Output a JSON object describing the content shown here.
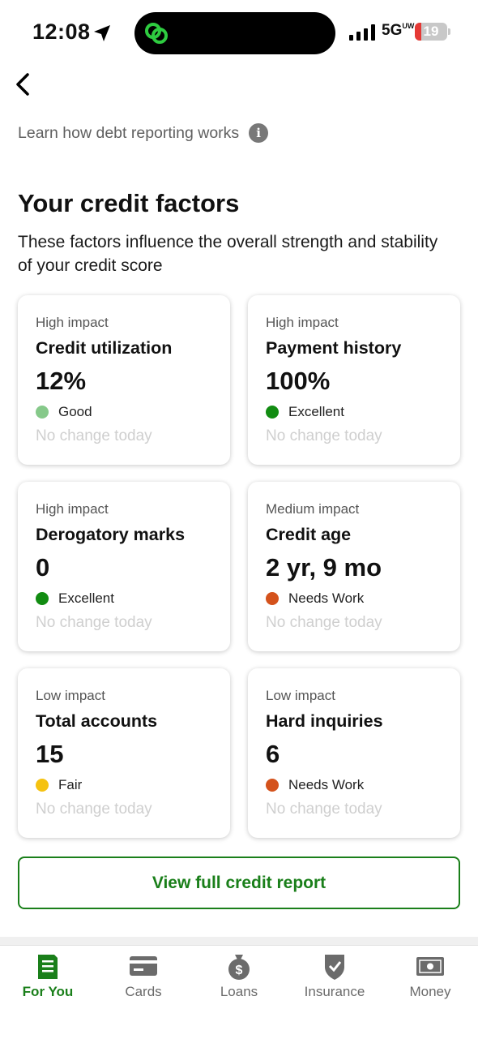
{
  "status_bar": {
    "time": "12:08",
    "network": "5G",
    "network_sub": "UW",
    "battery": "19",
    "battery_level": 0.19
  },
  "header": {
    "learn_link": "Learn how debt reporting works"
  },
  "section": {
    "title": "Your credit factors",
    "description": "These factors influence the overall strength and stability of your credit score"
  },
  "factors": [
    {
      "impact": "High impact",
      "name": "Credit utilization",
      "value": "12%",
      "rating": "Good",
      "rating_color": "#86c98a",
      "change": "No change today"
    },
    {
      "impact": "High impact",
      "name": "Payment history",
      "value": "100%",
      "rating": "Excellent",
      "rating_color": "#128c12",
      "change": "No change today"
    },
    {
      "impact": "High impact",
      "name": "Derogatory marks",
      "value": "0",
      "rating": "Excellent",
      "rating_color": "#128c12",
      "change": "No change today"
    },
    {
      "impact": "Medium impact",
      "name": "Credit age",
      "value": "2 yr, 9 mo",
      "rating": "Needs Work",
      "rating_color": "#d4521c",
      "change": "No change today"
    },
    {
      "impact": "Low impact",
      "name": "Total accounts",
      "value": "15",
      "rating": "Fair",
      "rating_color": "#f5c211",
      "change": "No change today"
    },
    {
      "impact": "Low impact",
      "name": "Hard inquiries",
      "value": "6",
      "rating": "Needs Work",
      "rating_color": "#d4521c",
      "change": "No change today"
    }
  ],
  "report_button": "View full credit report",
  "tabs": [
    {
      "label": "For You",
      "icon": "document-icon",
      "active": true
    },
    {
      "label": "Cards",
      "icon": "credit-card-icon",
      "active": false
    },
    {
      "label": "Loans",
      "icon": "money-bag-icon",
      "active": false
    },
    {
      "label": "Insurance",
      "icon": "shield-check-icon",
      "active": false
    },
    {
      "label": "Money",
      "icon": "banknote-icon",
      "active": false
    }
  ],
  "colors": {
    "brand_green": "#1a7f1a",
    "text_dark": "#111111",
    "muted": "#606060",
    "inactive_tab": "#6b6b6b"
  }
}
